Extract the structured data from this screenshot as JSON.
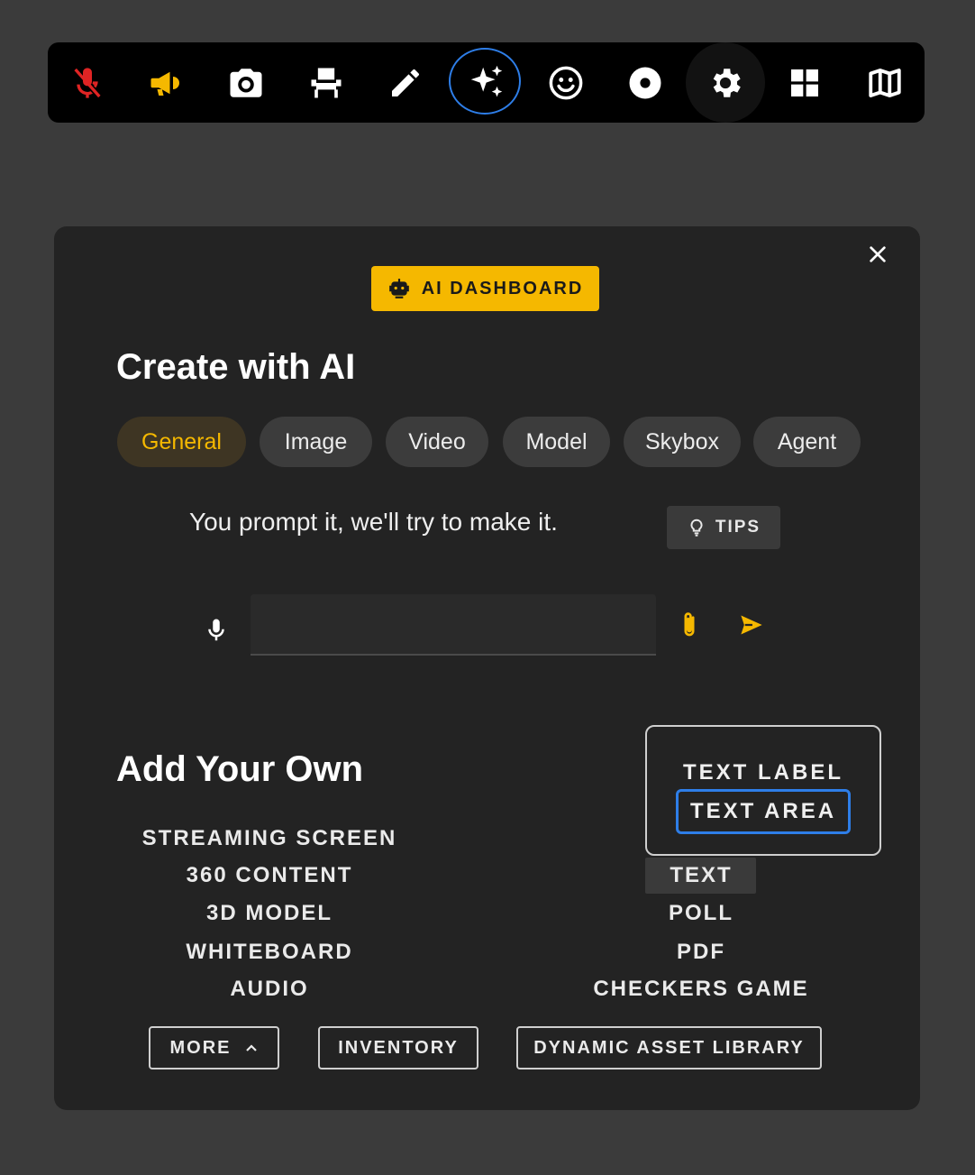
{
  "toolbar": {
    "buttons": [
      {
        "icon": "mic-muted-icon",
        "color": "#e02424",
        "active": false
      },
      {
        "icon": "megaphone-icon",
        "color": "#f5b800",
        "active": false
      },
      {
        "icon": "camera-icon",
        "color": "#ffffff",
        "active": false
      },
      {
        "icon": "seat-icon",
        "color": "#ffffff",
        "active": false
      },
      {
        "icon": "pencil-icon",
        "color": "#ffffff",
        "active": false
      },
      {
        "icon": "sparkles-icon",
        "color": "#ffffff",
        "active": true
      },
      {
        "icon": "smiley-icon",
        "color": "#ffffff",
        "active": false
      },
      {
        "icon": "record-icon",
        "color": "#ffffff",
        "active": false
      },
      {
        "icon": "gear-icon",
        "color": "#ffffff",
        "active": false
      },
      {
        "icon": "grid-icon",
        "color": "#ffffff",
        "active": false
      },
      {
        "icon": "map-icon",
        "color": "#ffffff",
        "active": false
      }
    ]
  },
  "panel": {
    "close_icon": "close-icon",
    "badge": {
      "label": "AI DASHBOARD",
      "icon": "robot-icon"
    },
    "title": "Create with AI",
    "tabs": [
      {
        "label": "General",
        "active": true
      },
      {
        "label": "Image",
        "active": false
      },
      {
        "label": "Video",
        "active": false
      },
      {
        "label": "Model",
        "active": false
      },
      {
        "label": "Skybox",
        "active": false
      },
      {
        "label": "Agent",
        "active": false
      }
    ],
    "prompt_hint": "You prompt it, we'll try to make it.",
    "tips_label": "TIPS",
    "prompt_input": {
      "value": "",
      "placeholder": ""
    },
    "add_title": "Add Your Own",
    "left_items": [
      "STREAMING SCREEN",
      "360 CONTENT",
      "3D MODEL",
      "WHITEBOARD",
      "AUDIO"
    ],
    "right_items": [
      "TEXT",
      "POLL",
      "PDF",
      "CHECKERS GAME"
    ],
    "text_menu": {
      "items": [
        "TEXT LABEL",
        "TEXT AREA"
      ],
      "focused": "TEXT AREA"
    },
    "bottom_buttons": {
      "more": "MORE",
      "inventory": "INVENTORY",
      "dynamic": "DYNAMIC ASSET LIBRARY"
    }
  },
  "colors": {
    "accent": "#f5b800",
    "focus": "#2e7ee8",
    "muted_red": "#e02424"
  }
}
